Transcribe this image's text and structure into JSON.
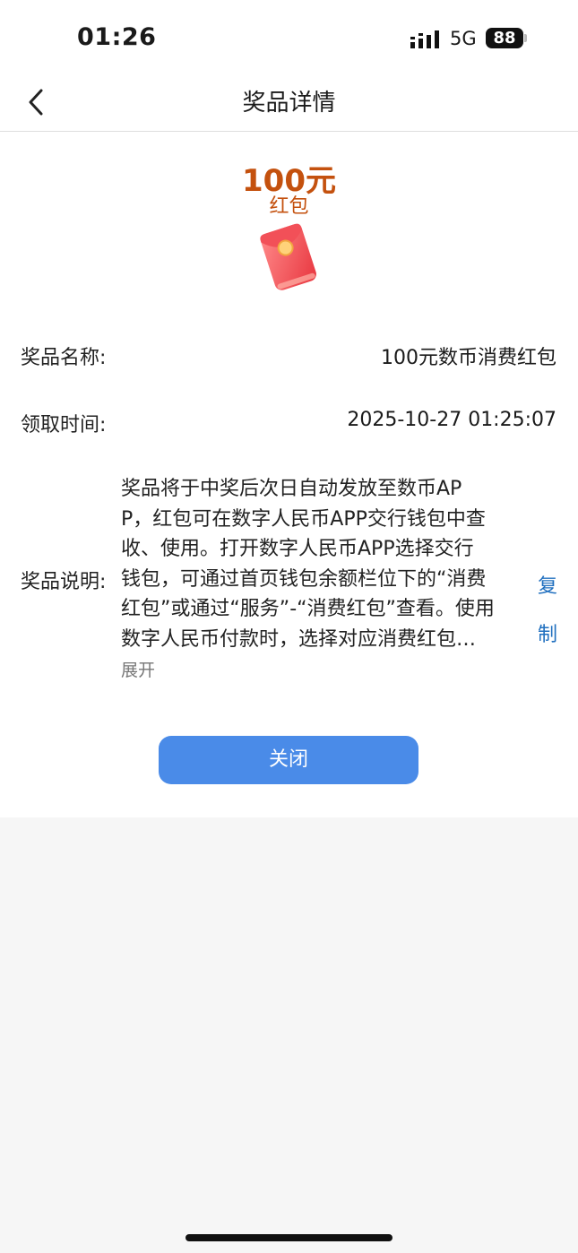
{
  "status_bar": {
    "time": "01:26",
    "network": "5G",
    "battery": "88"
  },
  "nav": {
    "title": "奖品详情"
  },
  "prize": {
    "amount": "100元",
    "type": "红包"
  },
  "details": {
    "name_label": "奖品名称:",
    "name_value": "100元数币消费红包",
    "time_label": "领取时间:",
    "time_value": "2025-10-27 01:25:07",
    "desc_label": "奖品说明:",
    "desc_lines": [
      "奖品将于中奖后次日自动发放至数币AP",
      "P，红包可在数字人民币APP交行钱包中查",
      "收、使用。打开数字人民币APP选择交行",
      "钱包，可通过首页钱包余额栏位下的“消费",
      "红包”或通过“服务”-“消费红包”查看。使用",
      "数字人民币付款时，选择对应消费红包…"
    ],
    "expand_label": "展开",
    "copy_label": "复制"
  },
  "buttons": {
    "close_label": "关闭"
  },
  "colors": {
    "accent": "#4a8be8",
    "prize": "#c4510e",
    "link": "#1f6fbf"
  },
  "icons": {
    "back": "chevron-left-icon",
    "envelope": "red-envelope-icon"
  }
}
